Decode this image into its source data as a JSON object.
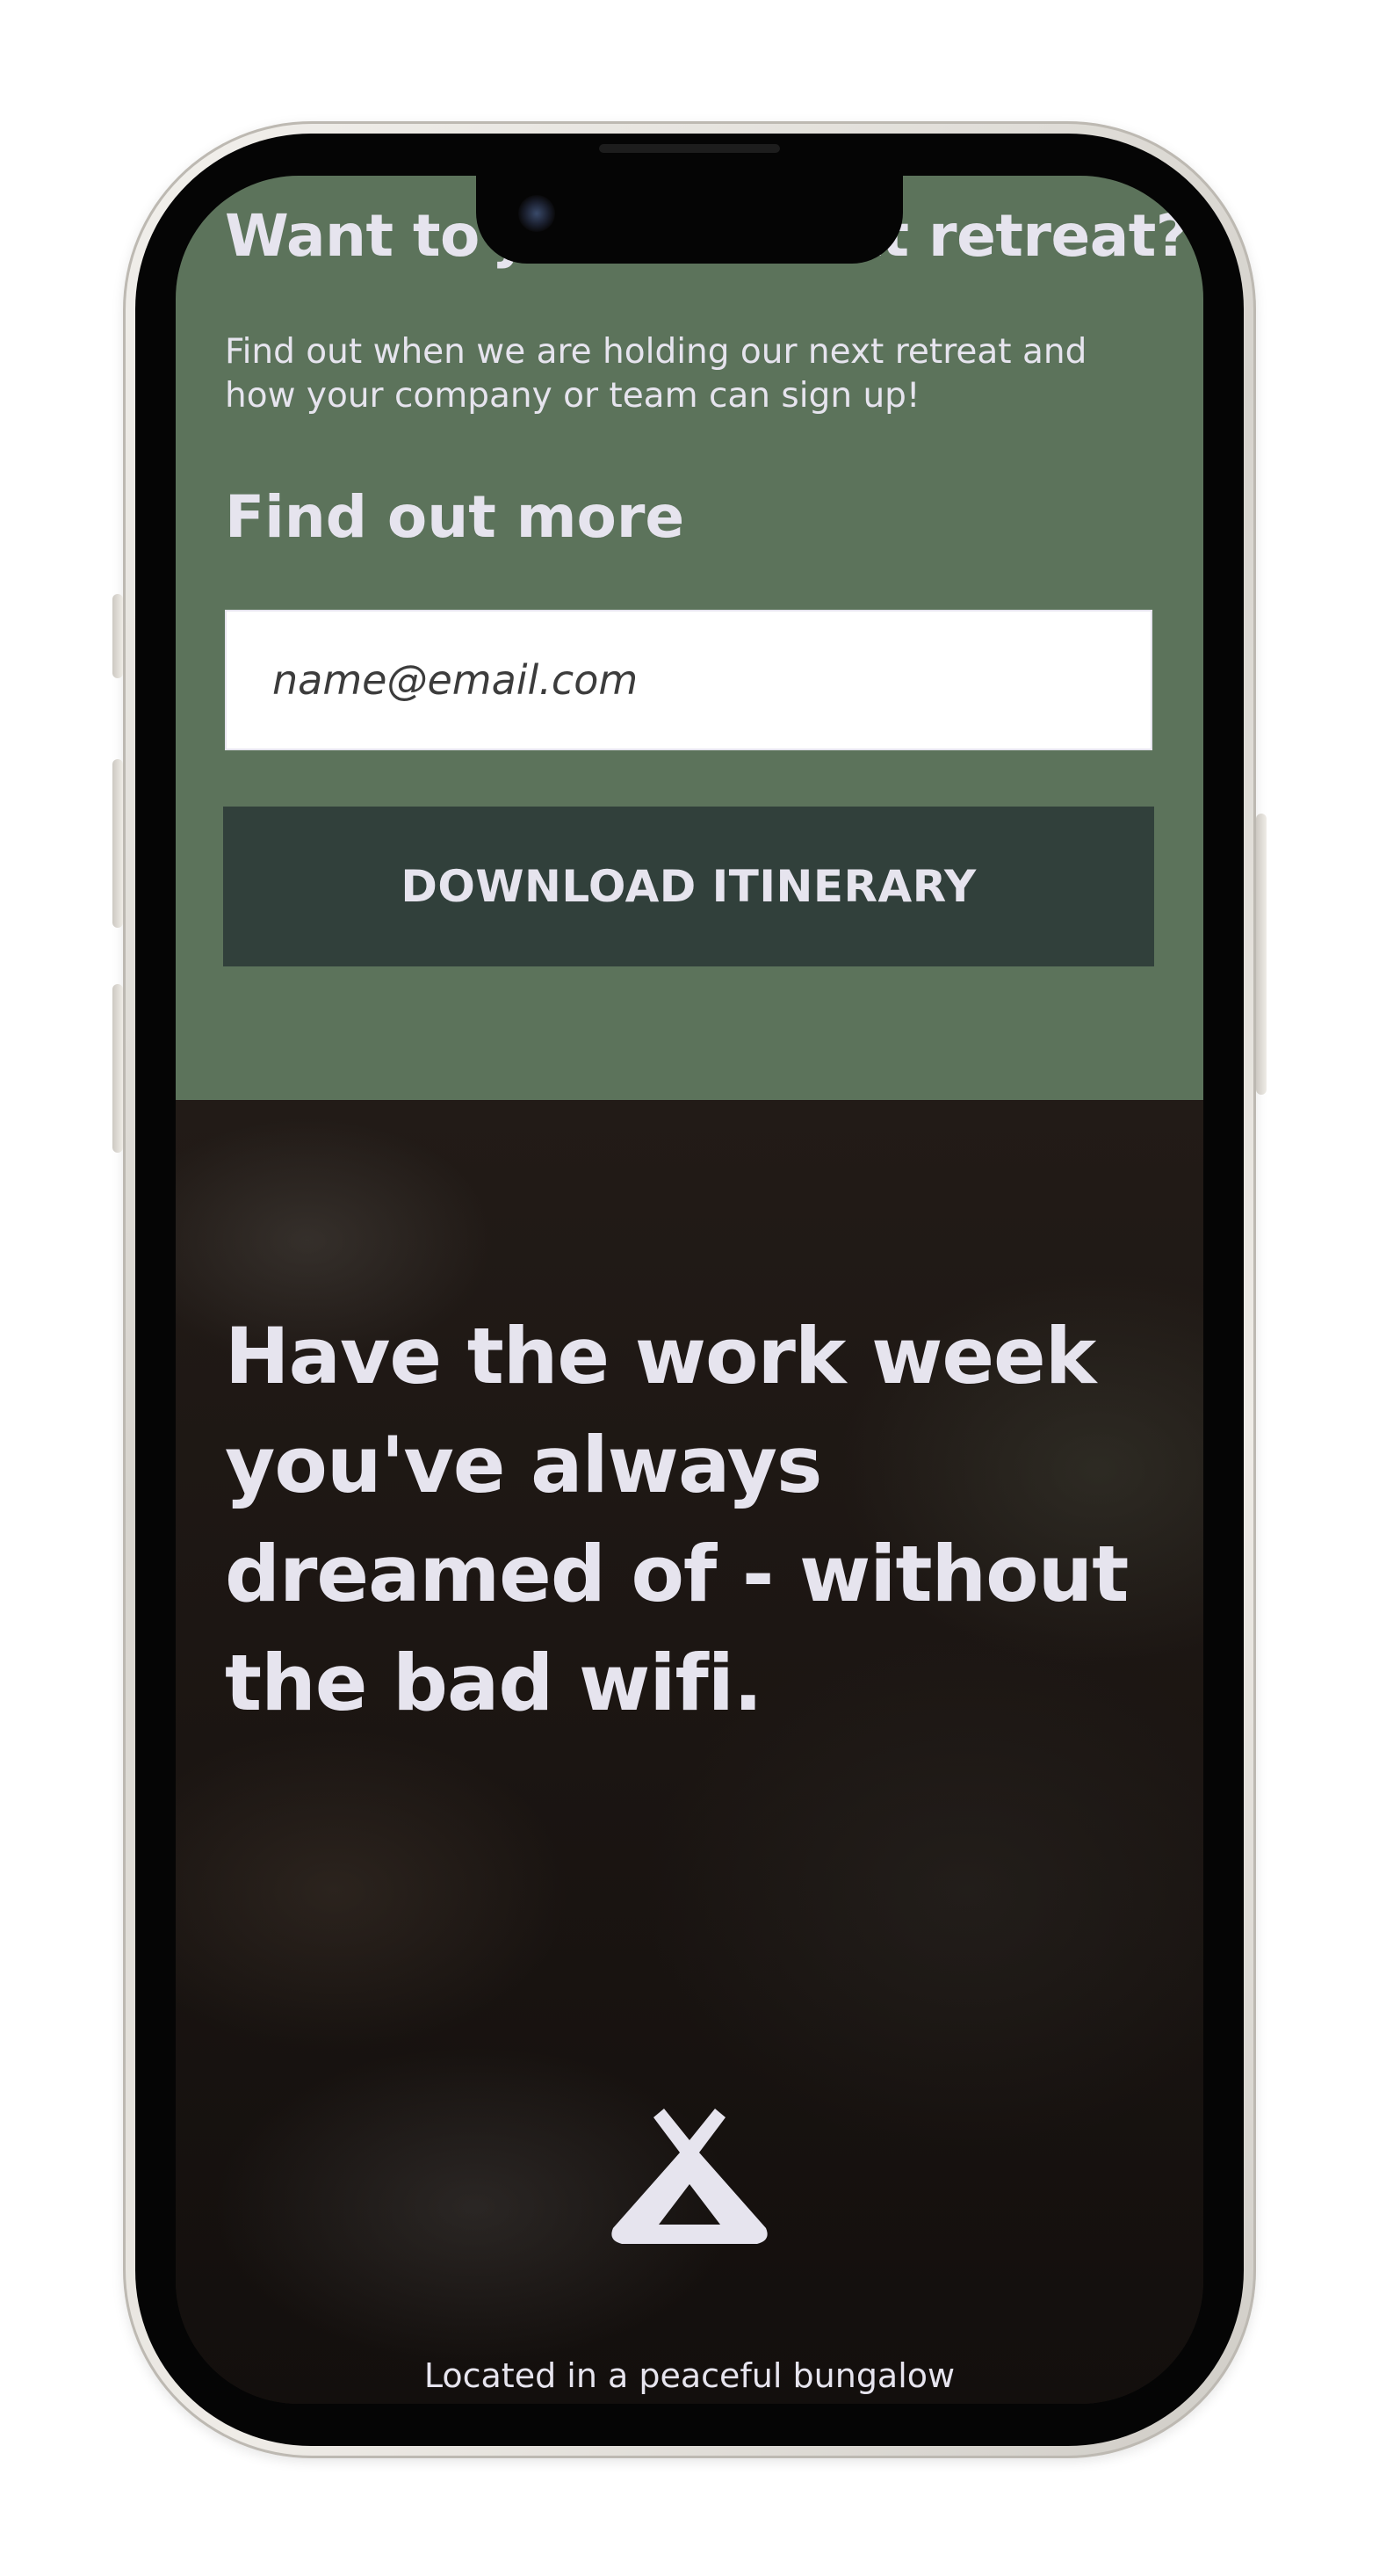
{
  "signup": {
    "title": "Want to join the next retreat?",
    "description": "Find out when we are holding our next retreat and how your company or team can sign up!",
    "subheading": "Find out more",
    "email_placeholder": "name@email.com",
    "button_label": "DOWNLOAD ITINERARY"
  },
  "hero": {
    "heading": "Have the work week you've always dreamed of - without the bad wifi.",
    "icon": "tent-icon",
    "location": "Located in a peaceful bungalow outside of Lake Geneva, Wisconsin."
  },
  "colors": {
    "signup_bg": "#5c735b",
    "button_bg": "#31403b",
    "text_light": "#e6e4ee",
    "hero_bg": "#1b1512"
  }
}
